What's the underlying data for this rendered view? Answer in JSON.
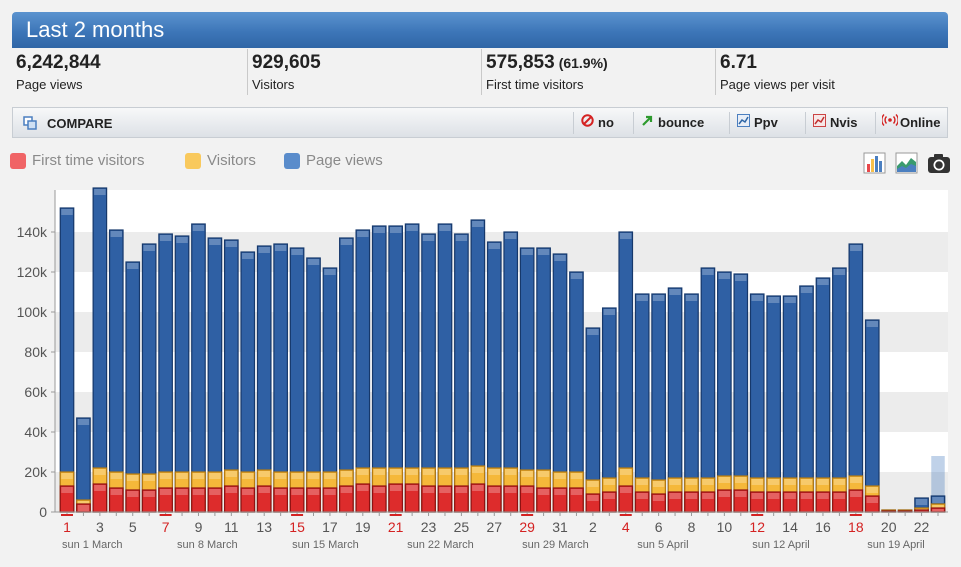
{
  "header": {
    "title": "Last 2 months"
  },
  "stats": [
    {
      "value": "6,242,844",
      "label": "Page views"
    },
    {
      "value": "929,605",
      "label": "Visitors"
    },
    {
      "value": "575,853",
      "pct": "(61.9%)",
      "label": "First time visitors"
    },
    {
      "value": "6.71",
      "label": "Page views per visit"
    }
  ],
  "compare": {
    "label": "COMPARE",
    "buttons": [
      {
        "label": "no",
        "icon": "no-entry-icon"
      },
      {
        "label": "bounce",
        "icon": "arrow-icon"
      },
      {
        "label": "Ppv",
        "icon": "mini-chart-icon"
      },
      {
        "label": "Nvis",
        "icon": "mini-chart-icon"
      },
      {
        "label": "Online",
        "icon": "signal-icon"
      }
    ]
  },
  "legend": [
    {
      "name": "First time visitors",
      "color": "#e8474a"
    },
    {
      "name": "Visitors",
      "color": "#f7c04a"
    },
    {
      "name": "Page views",
      "color": "#4b7fc0"
    }
  ],
  "tools": [
    "bar-chart-icon",
    "area-chart-icon",
    "camera-icon"
  ],
  "chart_data": {
    "type": "bar",
    "ylim": [
      0,
      150000
    ],
    "yticks": [
      "0",
      "20k",
      "40k",
      "60k",
      "80k",
      "100k",
      "120k",
      "140k"
    ],
    "ytick_values": [
      0,
      20000,
      40000,
      60000,
      80000,
      100000,
      120000,
      140000
    ],
    "x": [
      "1",
      "2",
      "3",
      "4",
      "5",
      "6",
      "7",
      "8",
      "9",
      "10",
      "11",
      "12",
      "13",
      "14",
      "15",
      "16",
      "17",
      "18",
      "19",
      "20",
      "21",
      "22",
      "23",
      "24",
      "25",
      "26",
      "27",
      "28",
      "29",
      "30",
      "31",
      "1",
      "2",
      "3",
      "4",
      "5",
      "6",
      "7",
      "8",
      "9",
      "10",
      "11",
      "12",
      "13",
      "14",
      "15",
      "16",
      "17",
      "18",
      "19",
      "20",
      "21",
      "22",
      "23"
    ],
    "xtick_labels": [
      {
        "i": 0,
        "label": "1",
        "red": true
      },
      {
        "i": 2,
        "label": "3",
        "red": false
      },
      {
        "i": 4,
        "label": "5",
        "red": false
      },
      {
        "i": 6,
        "label": "7",
        "red": true
      },
      {
        "i": 8,
        "label": "9",
        "red": false
      },
      {
        "i": 10,
        "label": "11",
        "red": false
      },
      {
        "i": 12,
        "label": "13",
        "red": false
      },
      {
        "i": 14,
        "label": "15",
        "red": true
      },
      {
        "i": 16,
        "label": "17",
        "red": false
      },
      {
        "i": 18,
        "label": "19",
        "red": false
      },
      {
        "i": 20,
        "label": "21",
        "red": true
      },
      {
        "i": 22,
        "label": "23",
        "red": false
      },
      {
        "i": 24,
        "label": "25",
        "red": false
      },
      {
        "i": 26,
        "label": "27",
        "red": false
      },
      {
        "i": 28,
        "label": "29",
        "red": true
      },
      {
        "i": 30,
        "label": "31",
        "red": false
      },
      {
        "i": 32,
        "label": "2",
        "red": false
      },
      {
        "i": 34,
        "label": "4",
        "red": true
      },
      {
        "i": 36,
        "label": "6",
        "red": false
      },
      {
        "i": 38,
        "label": "8",
        "red": false
      },
      {
        "i": 40,
        "label": "10",
        "red": false
      },
      {
        "i": 42,
        "label": "12",
        "red": true
      },
      {
        "i": 44,
        "label": "14",
        "red": false
      },
      {
        "i": 46,
        "label": "16",
        "red": false
      },
      {
        "i": 48,
        "label": "18",
        "red": true
      },
      {
        "i": 50,
        "label": "20",
        "red": false
      },
      {
        "i": 52,
        "label": "22",
        "red": false
      }
    ],
    "week_labels": [
      {
        "i": 0,
        "label": "sun 1 March"
      },
      {
        "i": 7,
        "label": "sun 8 March"
      },
      {
        "i": 14,
        "label": "sun 15 March"
      },
      {
        "i": 21,
        "label": "sun 22 March"
      },
      {
        "i": 28,
        "label": "sun 29 March"
      },
      {
        "i": 35,
        "label": "sun 5 April"
      },
      {
        "i": 42,
        "label": "sun 12 April"
      },
      {
        "i": 49,
        "label": "sun 19 April"
      }
    ],
    "series": [
      {
        "name": "Page views",
        "color": "#4b7fc0",
        "values": [
          152000,
          47000,
          162000,
          141000,
          125000,
          134000,
          139000,
          138000,
          144000,
          137000,
          136000,
          130000,
          133000,
          134000,
          132000,
          127000,
          122000,
          137000,
          141000,
          143000,
          143000,
          144000,
          139000,
          144000,
          139000,
          146000,
          135000,
          140000,
          132000,
          132000,
          129000,
          120000,
          92000,
          102000,
          140000,
          109000,
          109000,
          112000,
          109000,
          122000,
          120000,
          119000,
          109000,
          108000,
          108000,
          113000,
          117000,
          122000,
          134000,
          96000,
          1000,
          1000,
          7000,
          8000
        ]
      },
      {
        "name": "Visitors",
        "color": "#f7c04a",
        "values": [
          20000,
          6000,
          22000,
          20000,
          19000,
          19000,
          20000,
          20000,
          20000,
          20000,
          21000,
          20000,
          21000,
          20000,
          20000,
          20000,
          20000,
          21000,
          22000,
          22000,
          22000,
          22000,
          22000,
          22000,
          22000,
          23000,
          22000,
          22000,
          21000,
          21000,
          20000,
          20000,
          16000,
          17000,
          22000,
          17000,
          16000,
          17000,
          17000,
          17000,
          18000,
          18000,
          17000,
          17000,
          17000,
          17000,
          17000,
          17000,
          18000,
          13000,
          1000,
          1000,
          2000,
          4000
        ]
      },
      {
        "name": "First time visitors",
        "color": "#e8474a",
        "values": [
          13000,
          4000,
          14000,
          12000,
          11000,
          11000,
          12000,
          12000,
          12000,
          12000,
          13000,
          12000,
          13000,
          12000,
          12000,
          12000,
          12000,
          13000,
          14000,
          13000,
          14000,
          14000,
          13000,
          13000,
          13000,
          14000,
          13000,
          13000,
          13000,
          12000,
          12000,
          12000,
          9000,
          10000,
          13000,
          10000,
          9000,
          10000,
          10000,
          10000,
          11000,
          11000,
          10000,
          10000,
          10000,
          10000,
          10000,
          10000,
          11000,
          8000,
          500,
          500,
          1000,
          2000
        ]
      }
    ],
    "ghost_bar": {
      "index": 53,
      "value": 28000
    }
  }
}
